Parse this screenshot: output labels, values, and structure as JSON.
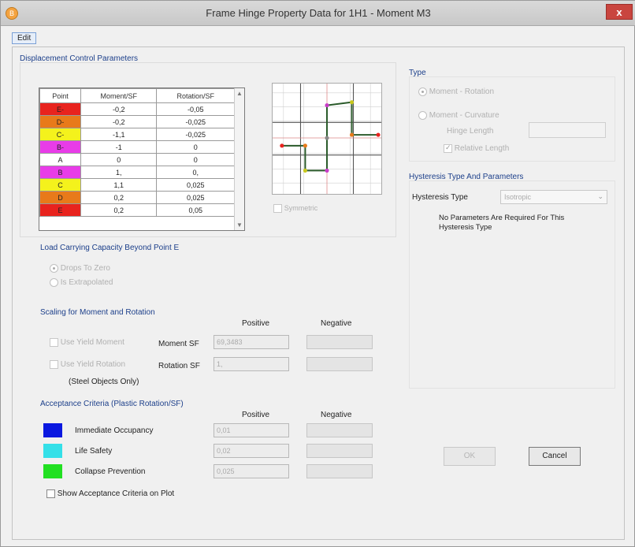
{
  "window": {
    "title": "Frame Hinge Property Data for 1H1 - Moment M3",
    "close_glyph": "x",
    "icon_glyph": "B"
  },
  "menu": {
    "edit": "Edit"
  },
  "displacement": {
    "title": "Displacement Control Parameters",
    "columns": [
      "Point",
      "Moment/SF",
      "Rotation/SF"
    ],
    "rows": [
      {
        "point": "E-",
        "moment": "-0,2",
        "rotation": "-0,05",
        "color": "#e8231e"
      },
      {
        "point": "D-",
        "moment": "-0,2",
        "rotation": "-0,025",
        "color": "#e87a1a"
      },
      {
        "point": "C-",
        "moment": "-1,1",
        "rotation": "-0,025",
        "color": "#f4f21c"
      },
      {
        "point": "B-",
        "moment": "-1",
        "rotation": "0",
        "color": "#e83ce8"
      },
      {
        "point": "A",
        "moment": "0",
        "rotation": "0",
        "color": "#ffffff"
      },
      {
        "point": "B",
        "moment": "1,",
        "rotation": "0,",
        "color": "#e83ce8"
      },
      {
        "point": "C",
        "moment": "1,1",
        "rotation": "0,025",
        "color": "#f4f21c"
      },
      {
        "point": "D",
        "moment": "0,2",
        "rotation": "0,025",
        "color": "#e87a1a"
      },
      {
        "point": "E",
        "moment": "0,2",
        "rotation": "0,05",
        "color": "#e8231e"
      }
    ],
    "symmetric_label": "Symmetric"
  },
  "load": {
    "title": "Load Carrying Capacity Beyond Point E",
    "option1": "Drops To Zero",
    "option2": "Is Extrapolated"
  },
  "scaling": {
    "title": "Scaling for Moment and Rotation",
    "positive_header": "Positive",
    "negative_header": "Negative",
    "use_yield_moment": "Use Yield Moment",
    "use_yield_rotation": "Use Yield Rotation",
    "steel_note": "(Steel Objects Only)",
    "moment_sf_label": "Moment SF",
    "rotation_sf_label": "Rotation SF",
    "moment_sf_pos": "69,3483",
    "rotation_sf_pos": "1,"
  },
  "acceptance": {
    "title": "Acceptance Criteria (Plastic Rotation/SF)",
    "positive_header": "Positive",
    "negative_header": "Negative",
    "rows": [
      {
        "label": "Immediate Occupancy",
        "value": "0,01",
        "color": "#0a18e0"
      },
      {
        "label": "Life Safety",
        "value": "0,02",
        "color": "#34e0e8"
      },
      {
        "label": "Collapse Prevention",
        "value": "0,025",
        "color": "#22e022"
      }
    ],
    "show_on_plot": "Show Acceptance Criteria on Plot"
  },
  "type": {
    "title": "Type",
    "moment_rotation": "Moment - Rotation",
    "moment_curvature": "Moment - Curvature",
    "hinge_length": "Hinge Length",
    "relative_length": "Relative Length"
  },
  "hysteresis": {
    "title": "Hysteresis Type And Parameters",
    "type_label": "Hysteresis Type",
    "type_value": "Isotropic",
    "note": "No Parameters Are Required For This Hysteresis Type"
  },
  "buttons": {
    "ok": "OK",
    "cancel": "Cancel"
  }
}
